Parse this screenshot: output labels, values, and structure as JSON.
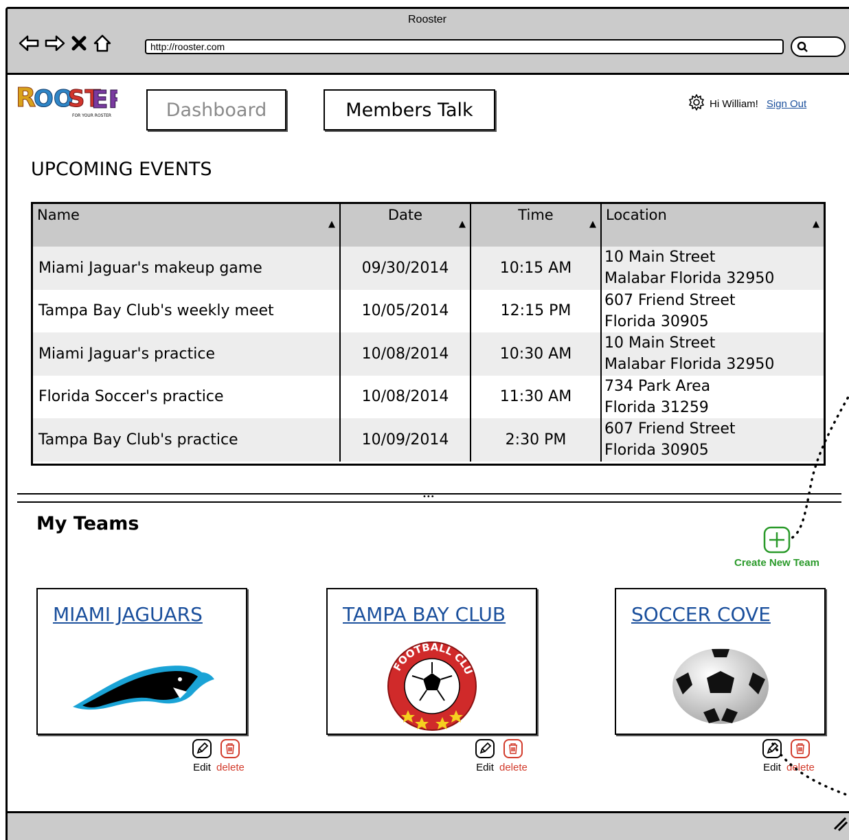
{
  "window": {
    "title": "Rooster"
  },
  "browser": {
    "url": "http://rooster.com"
  },
  "header": {
    "logo_text": "ROOSTER",
    "logo_tagline": "FOR YOUR ROSTER",
    "nav": {
      "dashboard": "Dashboard",
      "members_talk": "Members Talk"
    },
    "greeting": "Hi William!",
    "sign_out": "Sign Out"
  },
  "events": {
    "title": "UPCOMING EVENTS",
    "columns": [
      "Name",
      "Date",
      "Time",
      "Location"
    ],
    "rows": [
      {
        "name": "Miami Jaguar's makeup game",
        "date": "09/30/2014",
        "time": "10:15 AM",
        "loc1": "10 Main Street",
        "loc2": "Malabar Florida 32950"
      },
      {
        "name": "Tampa Bay Club's weekly meet",
        "date": "10/05/2014",
        "time": "12:15 PM",
        "loc1": "607 Friend Street",
        "loc2": "Florida 30905"
      },
      {
        "name": "Miami Jaguar's practice",
        "date": "10/08/2014",
        "time": "10:30 AM",
        "loc1": "10 Main Street",
        "loc2": "Malabar Florida 32950"
      },
      {
        "name": "Florida Soccer's practice",
        "date": "10/08/2014",
        "time": "11:30 AM",
        "loc1": "734 Park Area",
        "loc2": "Florida 31259"
      },
      {
        "name": "Tampa Bay Club's practice",
        "date": "10/09/2014",
        "time": "2:30 PM",
        "loc1": "607 Friend Street",
        "loc2": "Florida 30905"
      }
    ]
  },
  "teams": {
    "title": "My Teams",
    "create_label": "Create New Team",
    "edit_label": "Edit",
    "delete_label": "delete",
    "items": [
      {
        "name": "MIAMI JAGUARS",
        "image": "panther-logo"
      },
      {
        "name": "TAMPA BAY CLUB",
        "image": "football-club-badge",
        "badge_text": "FOOTBALL CLUB"
      },
      {
        "name": "SOCCER COVE",
        "image": "soccer-ball"
      }
    ]
  },
  "colors": {
    "link": "#1a4f9c",
    "create": "#2a9a2a",
    "delete": "#d23a2a",
    "chrome": "#cbcbcb"
  }
}
